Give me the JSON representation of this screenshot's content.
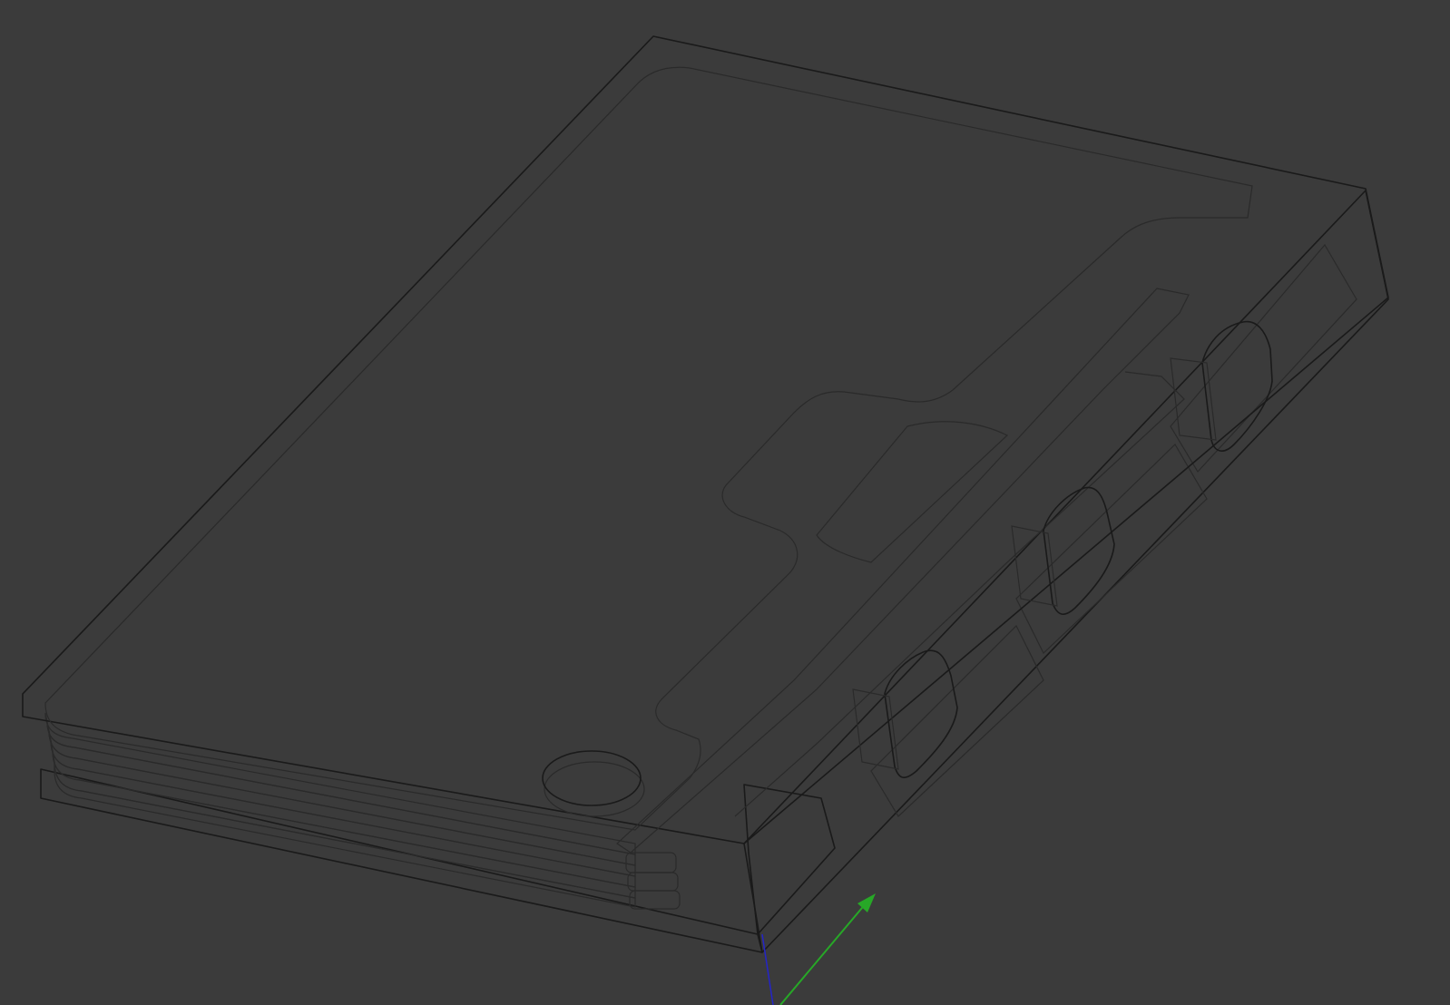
{
  "viewport": {
    "background": "#3b3b3b"
  },
  "colors": {
    "case_shell": "#5a5d61",
    "lid_fill": "#48606e",
    "lid_alpha": 0.8,
    "rail_purple": "#6a4f78",
    "swatch_purple": "#7a3fa2",
    "swatch_green": "#123f15",
    "swatch_red": "#4a1111",
    "button_tan": "#7c5c52",
    "stack_light_cyan": "#2aa6e0",
    "stack_cyan": "#1f8fd0",
    "stack_blue": "#1d5fc8",
    "stack_mid_blue": "#1c3fae",
    "stack_dark_blue": "#16249a",
    "stack_navy": "#101a6e",
    "axis_green": "#27a827",
    "axis_blue": "#2424c8"
  },
  "parts": [
    {
      "name": "enclosure-bottom-shell"
    },
    {
      "name": "transparent-lid-panel"
    },
    {
      "name": "layered-stack-blue"
    },
    {
      "name": "purple-rail"
    },
    {
      "name": "purple-key-cap"
    },
    {
      "name": "green-key-cap"
    },
    {
      "name": "red-key-cap"
    },
    {
      "name": "round-tan-button"
    }
  ],
  "axes": {
    "icon": "axis-triad-icon"
  }
}
